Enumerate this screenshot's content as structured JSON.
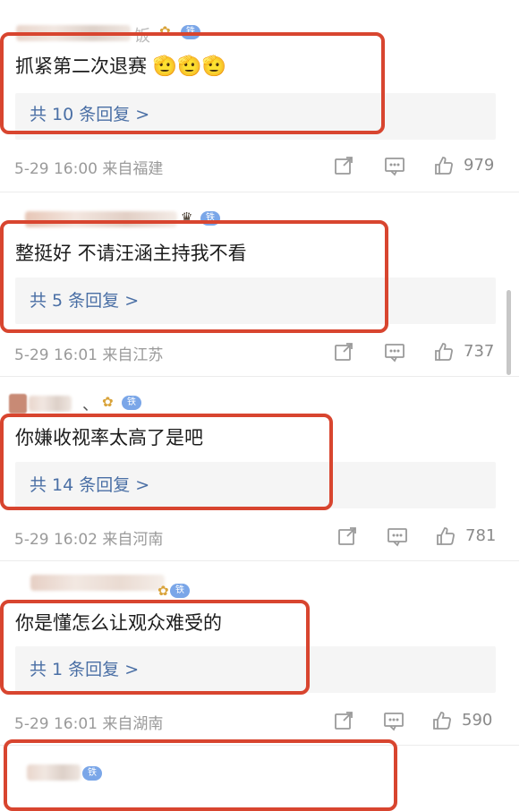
{
  "comments": [
    {
      "badge": "铁粉1",
      "name_fragment": "饭",
      "text": "抓紧第二次退赛",
      "emoji": "🫡🫡🫡",
      "replies": "共 10 条回复 >",
      "meta": "5-29 16:00 来自福建",
      "likes": "979"
    },
    {
      "badge": "铁粉1",
      "text": "整挺好 不请汪涵主持我不看",
      "replies": "共 5 条回复 >",
      "meta": "5-29 16:01 来自江苏",
      "likes": "737"
    },
    {
      "badge": "铁粉1",
      "name_fragment": "、",
      "text": "你嫌收视率太高了是吧",
      "replies": "共 14 条回复 >",
      "meta": "5-29 16:02 来自河南",
      "likes": "781"
    },
    {
      "badge": "铁粉1",
      "text": "你是懂怎么让观众难受的",
      "replies": "共 1 条回复 >",
      "meta": "5-29 16:01 来自湖南",
      "likes": "590"
    },
    {
      "badge": "铁粉1"
    }
  ],
  "colors": {
    "highlight": "#d8452f",
    "reply_link": "#4a6fa5",
    "badge": "#7aa6e8",
    "meta": "#9a9a9a"
  },
  "icons": [
    "share-icon",
    "comment-icon",
    "like-icon",
    "crown-icon"
  ]
}
